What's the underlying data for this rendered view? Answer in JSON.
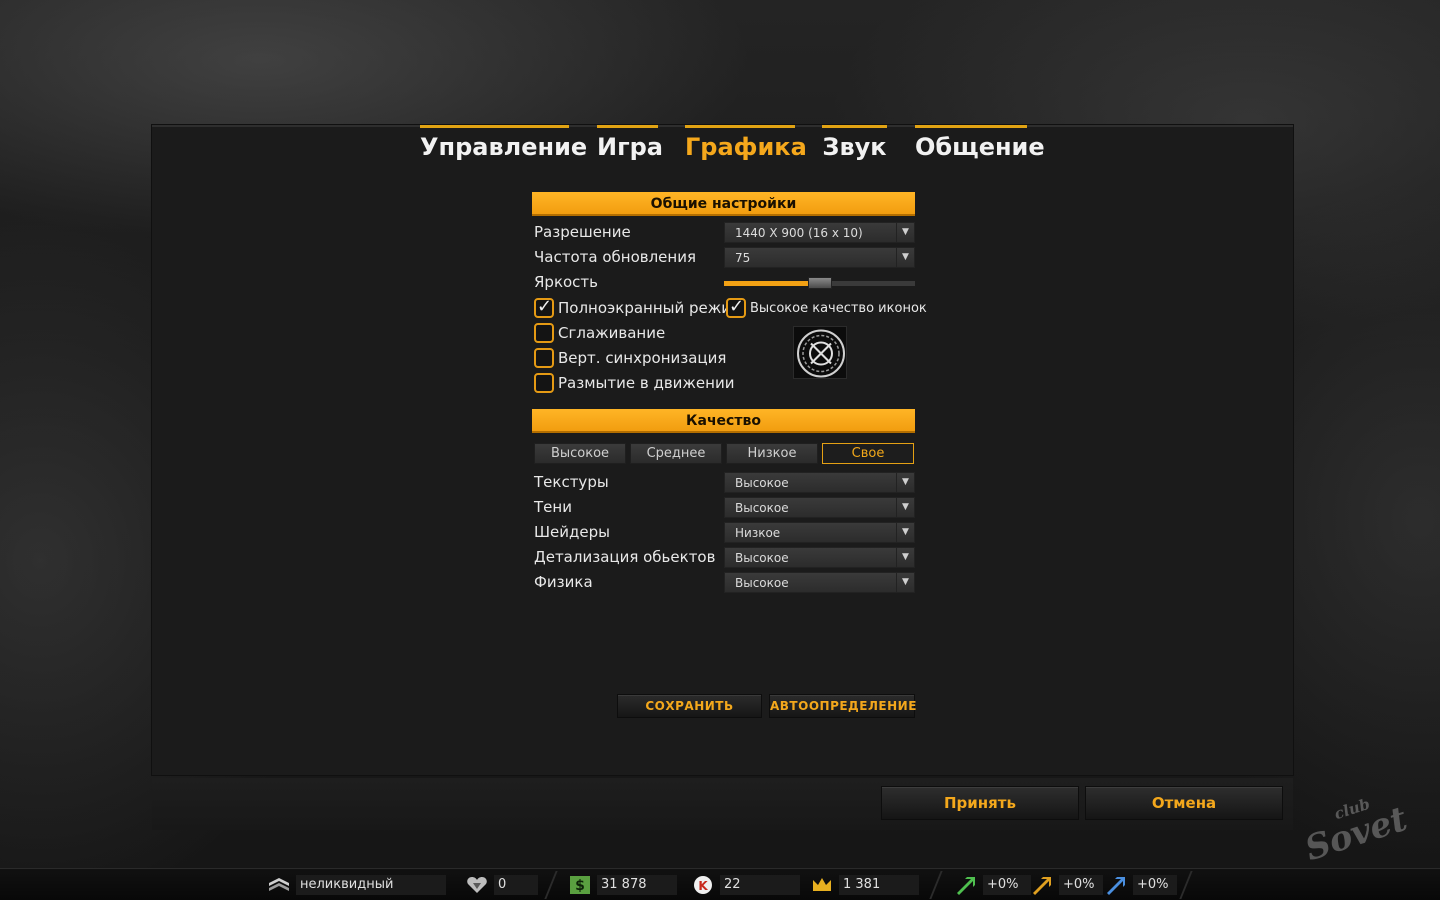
{
  "tabs": [
    {
      "label": "Управление",
      "active": false
    },
    {
      "label": "Игра",
      "active": false
    },
    {
      "label": "Графика",
      "active": true
    },
    {
      "label": "Звук",
      "active": false
    },
    {
      "label": "Общение",
      "active": false
    }
  ],
  "general": {
    "header": "Общие настройки",
    "resolution": {
      "label": "Разрешение",
      "value": "1440 X 900 (16 x 10)"
    },
    "refresh": {
      "label": "Частота обновления",
      "value": "75"
    },
    "brightness": {
      "label": "Яркость",
      "level": 0.5
    },
    "checkboxes": {
      "fullscreen": {
        "label": "Полноэкранный режим",
        "checked": true
      },
      "hq_icons": {
        "label": "Высокое качество иконок",
        "checked": true
      },
      "antialias": {
        "label": "Сглаживание",
        "checked": false
      },
      "vsync": {
        "label": "Верт. синхронизация",
        "checked": false
      },
      "motion_blur": {
        "label": "Размытие в движении",
        "checked": false
      }
    }
  },
  "quality": {
    "header": "Качество",
    "presets": [
      "Высокое",
      "Среднее",
      "Низкое",
      "Свое"
    ],
    "active_preset": "Свое",
    "textures": {
      "label": "Текстуры",
      "value": "Высокое"
    },
    "shadows": {
      "label": "Тени",
      "value": "Высокое"
    },
    "shaders": {
      "label": "Шейдеры",
      "value": "Низкое"
    },
    "detail": {
      "label": "Детализация обьектов",
      "value": "Высокое"
    },
    "physics": {
      "label": "Физика",
      "value": "Высокое"
    }
  },
  "buttons": {
    "save": "СОХРАНИТЬ",
    "autodetect": "АВТООПРЕДЕЛЕНИЕ",
    "accept": "Принять",
    "cancel": "Отмена"
  },
  "watermark": {
    "line1": "club",
    "line2": "Sovet"
  },
  "statusbar": {
    "rank": "неликвидный",
    "karma": "0",
    "money": "31 878",
    "k": "22",
    "crown": "1 381",
    "bonus1": "+0%",
    "bonus2": "+0%",
    "bonus3": "+0%"
  },
  "colors": {
    "accent": "#f5a81c",
    "header_bg": "#ffb526",
    "background": "#1b1b1b"
  }
}
